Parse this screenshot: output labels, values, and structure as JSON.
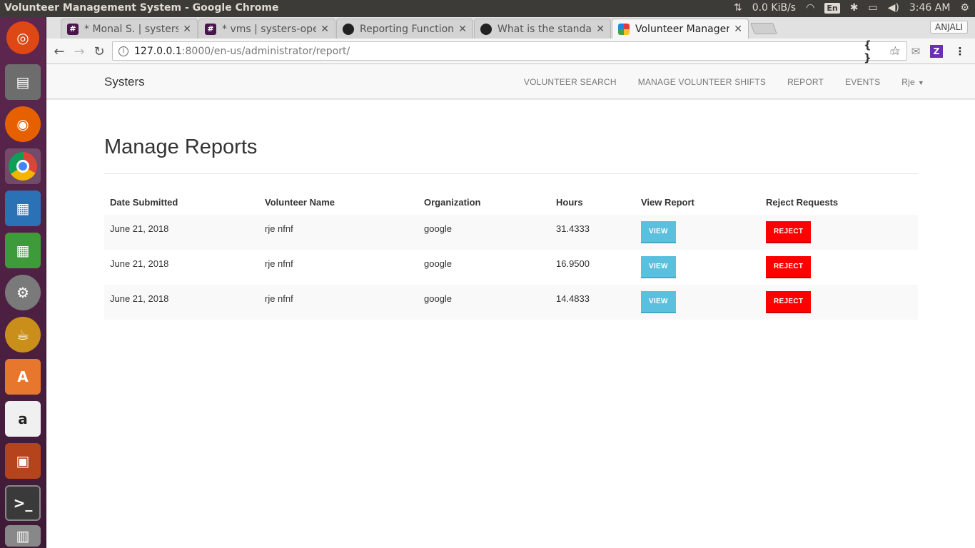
{
  "system": {
    "window_title": "Volunteer Management System - Google Chrome",
    "network": "0.0 KiB/s",
    "keyboard": "En",
    "time": "3:46 AM"
  },
  "launcher": {
    "items": [
      "ubuntu-logo",
      "files",
      "firefox",
      "chrome",
      "writer",
      "calc",
      "system-settings",
      "teapot",
      "software-center",
      "amazon",
      "impress",
      "terminal",
      "trash"
    ]
  },
  "browser": {
    "profile": "ANJALI",
    "tabs": [
      {
        "title": "* Monal S. | systers-",
        "favicon": "#"
      },
      {
        "title": "* vms | systers-oper",
        "favicon": "#"
      },
      {
        "title": "Reporting Function",
        "favicon": "github"
      },
      {
        "title": "What is the standar",
        "favicon": "github"
      },
      {
        "title": "Volunteer Manager",
        "favicon": "vms"
      }
    ],
    "url_host": "127.0.0.1",
    "url_rest": ":8000/en-us/administrator/report/"
  },
  "navbar": {
    "brand": "Systers",
    "links": [
      "VOLUNTEER SEARCH",
      "MANAGE VOLUNTEER SHIFTS",
      "REPORT",
      "EVENTS"
    ],
    "user": "Rje"
  },
  "page": {
    "title": "Manage Reports"
  },
  "table": {
    "headers": [
      "Date Submitted",
      "Volunteer Name",
      "Organization",
      "Hours",
      "View Report",
      "Reject Requests"
    ],
    "rows": [
      {
        "date": "June 21, 2018",
        "name": "rje nfnf",
        "org": "google",
        "hours": "31.4333",
        "view": "VIEW",
        "reject": "REJECT"
      },
      {
        "date": "June 21, 2018",
        "name": "rje nfnf",
        "org": "google",
        "hours": "16.9500",
        "view": "VIEW",
        "reject": "REJECT"
      },
      {
        "date": "June 21, 2018",
        "name": "rje nfnf",
        "org": "google",
        "hours": "14.4833",
        "view": "VIEW",
        "reject": "REJECT"
      }
    ]
  },
  "colors": {
    "view_button": "#5bc0de",
    "reject_button": "#ff0000",
    "launcher": "#5e2750",
    "topbar": "#3c3b37"
  }
}
